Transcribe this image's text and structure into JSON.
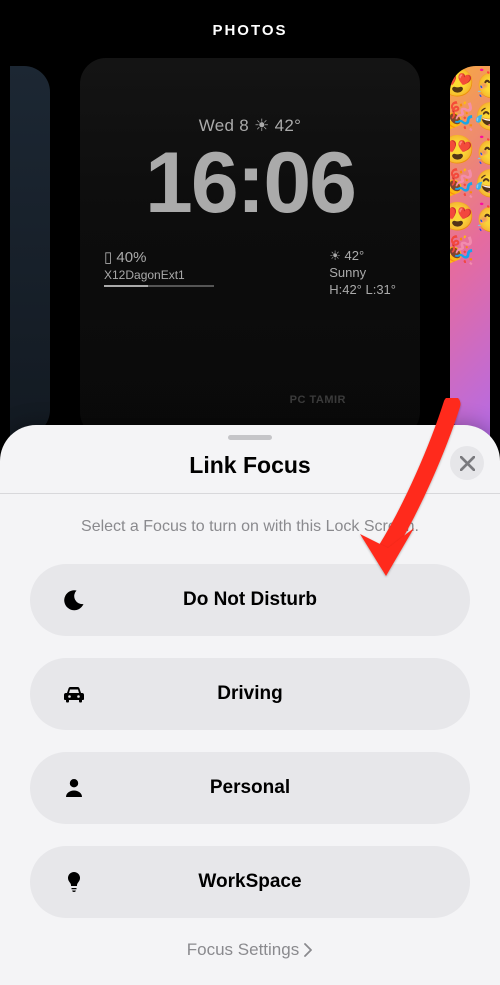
{
  "header": {
    "title": "PHOTOS"
  },
  "wallpaper": {
    "date_line": "Wed 8  ☀︎  42°",
    "clock": "16:06",
    "battery_line": "▯ 40%",
    "wifi_line": "X12DagonExt1",
    "weather_temp": "☀︎  42°",
    "weather_cond": "Sunny",
    "weather_hilo": "H:42° L:31°",
    "sign_text": "PC TAMIR"
  },
  "sheet": {
    "title": "Link Focus",
    "subtitle": "Select a Focus to turn on with this Lock Screen.",
    "items": [
      {
        "label": "Do Not Disturb",
        "icon": "moon"
      },
      {
        "label": "Driving",
        "icon": "car"
      },
      {
        "label": "Personal",
        "icon": "person"
      },
      {
        "label": "WorkSpace",
        "icon": "bulb"
      }
    ],
    "settings_label": "Focus Settings"
  }
}
